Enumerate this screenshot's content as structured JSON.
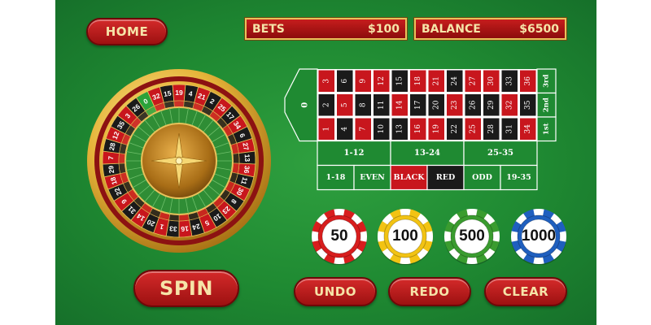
{
  "header": {
    "home_label": "HOME",
    "bets_label": "BETS",
    "bets_value": "$100",
    "balance_label": "BALANCE",
    "balance_value": "$6500"
  },
  "wheel": {
    "numbers": [
      "0",
      "32",
      "15",
      "19",
      "4",
      "21",
      "2",
      "25",
      "17",
      "34",
      "6",
      "27",
      "13",
      "36",
      "11",
      "30",
      "8",
      "23",
      "10",
      "5",
      "24",
      "16",
      "33",
      "1",
      "20",
      "14",
      "31",
      "9",
      "22",
      "18",
      "29",
      "7",
      "28",
      "12",
      "35",
      "3",
      "26"
    ],
    "center_icon": "compass-star-icon"
  },
  "board": {
    "zero": "0",
    "rows": [
      [
        "3",
        "6",
        "9",
        "12",
        "15",
        "18",
        "21",
        "24",
        "27",
        "30",
        "33",
        "36"
      ],
      [
        "2",
        "5",
        "8",
        "11",
        "14",
        "17",
        "20",
        "23",
        "26",
        "29",
        "32",
        "35"
      ],
      [
        "1",
        "4",
        "7",
        "10",
        "13",
        "16",
        "19",
        "22",
        "25",
        "28",
        "31",
        "34"
      ]
    ],
    "row_labels": [
      "3rd",
      "2nd",
      "1st"
    ],
    "dozens": [
      "1-12",
      "13-24",
      "25-35"
    ],
    "outside": [
      "1-18",
      "EVEN",
      "BLACK",
      "RED",
      "ODD",
      "19-35"
    ]
  },
  "chips": [
    {
      "value": "50",
      "color": "#d81d1d"
    },
    {
      "value": "100",
      "color": "#f2c313"
    },
    {
      "value": "500",
      "color": "#3a9c2f"
    },
    {
      "value": "1000",
      "color": "#1f5fbf"
    }
  ],
  "controls": {
    "spin_label": "SPIN",
    "undo_label": "UNDO",
    "redo_label": "REDO",
    "clear_label": "CLEAR"
  },
  "colors": {
    "table_green": "#1f8a32",
    "red": "#c8161d",
    "black": "#1a1a1a",
    "gold": "#e9c25a"
  }
}
